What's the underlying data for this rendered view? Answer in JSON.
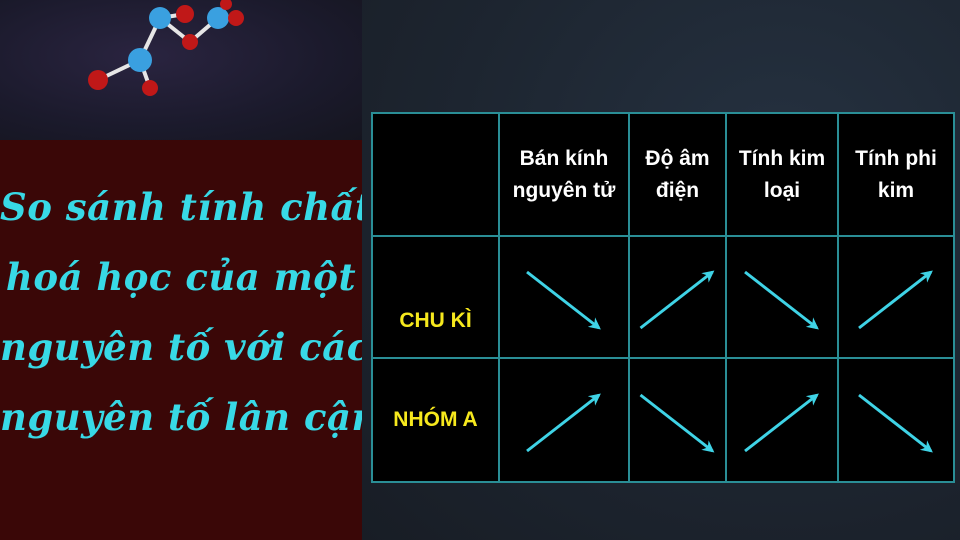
{
  "left_panel": {
    "title_lines": [
      "So sánh tính chất",
      "hoá học của một",
      "nguyên tố với các",
      "nguyên tố lân cận"
    ]
  },
  "table": {
    "headers": [
      "",
      "Bán kính nguyên tử",
      "Độ âm điện",
      "Tính kim loại",
      "Tính phi kim"
    ],
    "header_lines": [
      [
        "Bán kính",
        "nguyên tử"
      ],
      [
        "Độ âm",
        "điện"
      ],
      [
        "Tính kim",
        "loại"
      ],
      [
        "Tính phi",
        "kim"
      ]
    ],
    "rows": [
      {
        "label": "CHU KÌ",
        "trends": [
          "down",
          "up",
          "down",
          "up"
        ]
      },
      {
        "label": "NHÓM A",
        "trends": [
          "up",
          "down",
          "up",
          "down"
        ]
      }
    ]
  },
  "colors": {
    "title": "#38d9e6",
    "row_label": "#f6e81d",
    "arrow": "#3fd3e6",
    "grid": "#2a8e96",
    "left_panel_bg": "#3a0707"
  },
  "icons": {
    "molecule": "molecule-icon"
  }
}
